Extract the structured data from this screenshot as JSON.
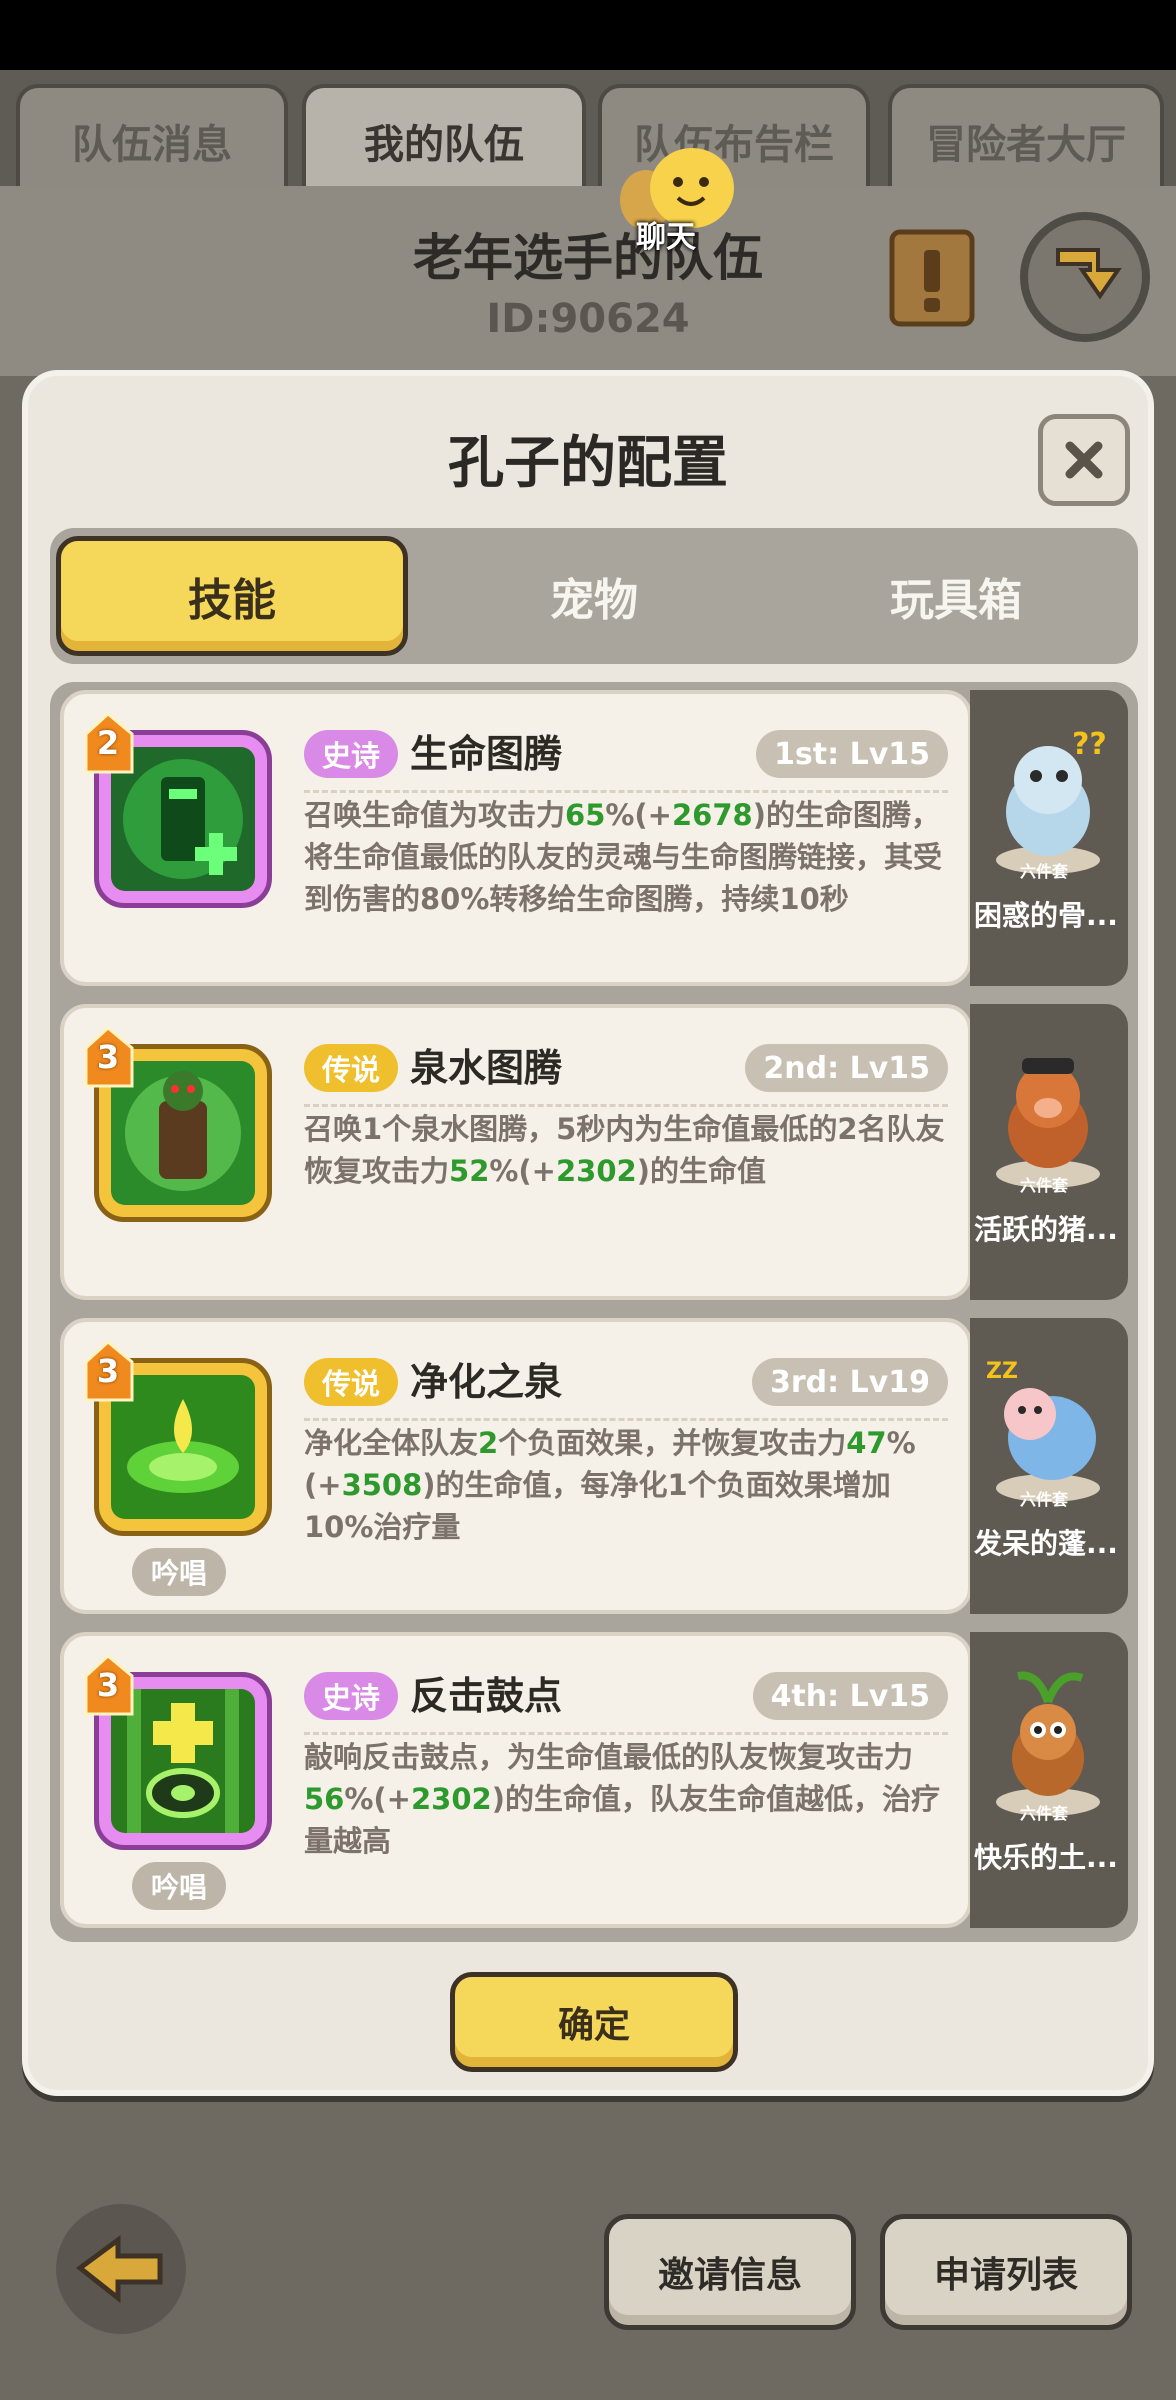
{
  "top_tabs": [
    {
      "label": "队伍消息"
    },
    {
      "label": "我的队伍"
    },
    {
      "label": "队伍布告栏"
    },
    {
      "label": "冒险者大厅"
    }
  ],
  "team": {
    "name": "老年选手的队伍",
    "id": "ID:90624",
    "chat_label": "聊天"
  },
  "dialog": {
    "title": "孔子的配置",
    "tabs": [
      "技能",
      "宠物",
      "玩具箱"
    ],
    "confirm_label": "确定"
  },
  "skills": [
    {
      "level": "2",
      "rarity": "史诗",
      "name": "生命图腾",
      "slot": "1st: Lv15",
      "desc_parts": [
        "召唤生命值为攻击力",
        "65",
        "%(+",
        "2678",
        ")的生命图腾，将生命值最低的队友的灵魂与生命图腾链接，其受到伤害的80%转移给生命图腾，持续10秒"
      ],
      "icon": "life-totem-icon",
      "chant": ""
    },
    {
      "level": "3",
      "rarity": "传说",
      "name": "泉水图腾",
      "slot": "2nd: Lv15",
      "desc_parts": [
        "召唤1个泉水图腾，5秒内为生命值最低的2名队友恢复攻击力",
        "52",
        "%(+",
        "2302",
        ")的生命值"
      ],
      "icon": "spring-totem-icon",
      "chant": ""
    },
    {
      "level": "3",
      "rarity": "传说",
      "name": "净化之泉",
      "slot": "3rd: Lv19",
      "desc_parts": [
        "净化全体队友",
        "2",
        "个负面效果，并恢复攻击力",
        "47",
        "%(+",
        "3508",
        ")的生命值，每净化1个负面效果增加10%治疗量"
      ],
      "icon": "purify-spring-icon",
      "chant": "吟唱"
    },
    {
      "level": "3",
      "rarity": "史诗",
      "name": "反击鼓点",
      "slot": "4th: Lv15",
      "desc_parts": [
        "敲响反击鼓点，为生命值最低的队友恢复攻击力",
        "56",
        "%(+",
        "2302",
        ")的生命值，队友生命值越低，治疗量越高"
      ],
      "icon": "counter-drum-icon",
      "chant": "吟唱"
    }
  ],
  "pets": [
    {
      "set": "六件套",
      "name": "困惑的骨..."
    },
    {
      "set": "六件套",
      "name": "活跃的猪..."
    },
    {
      "set": "六件套",
      "name": "发呆的蓬..."
    },
    {
      "set": "六件套",
      "name": "快乐的土..."
    }
  ],
  "bottom": {
    "invite_label": "邀请信息",
    "apply_label": "申请列表"
  },
  "colors": {
    "accent_yellow": "#f5d85a",
    "epic": "#d98ae6",
    "legend": "#f0bf2e",
    "highlight_green": "#2e9a2e"
  }
}
